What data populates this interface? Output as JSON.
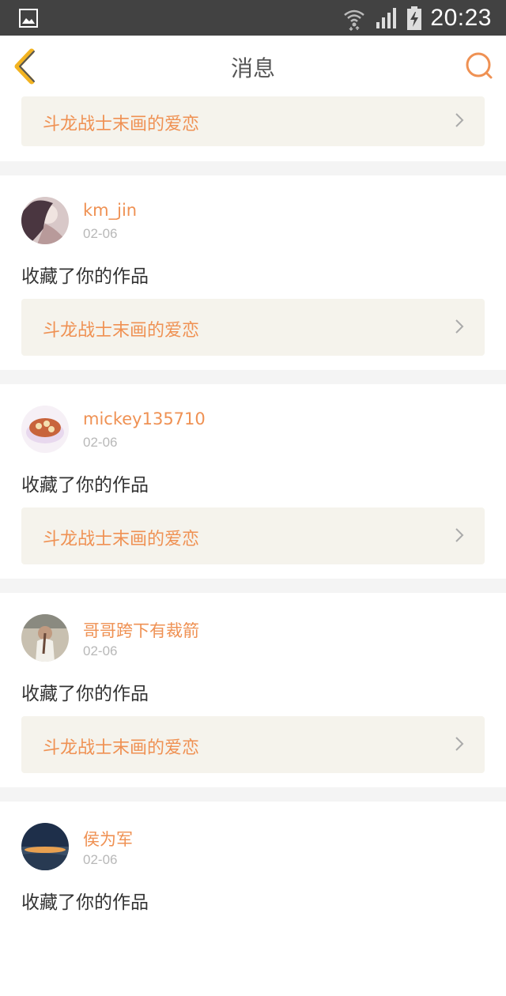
{
  "status_bar": {
    "time": "20:23",
    "icons": [
      "gallery-icon",
      "wifi-icon",
      "signal-icon",
      "battery-charging-icon"
    ]
  },
  "nav": {
    "title": "消息",
    "back_icon": "chevron-left-icon",
    "search_icon": "search-icon"
  },
  "colors": {
    "accent": "#ef9153",
    "back_icon": "#f2b321",
    "link_bg": "#f5f3ec"
  },
  "top_partial": {
    "work_title": "斗龙战士末画的爱恋"
  },
  "messages": [
    {
      "username": "km_jin",
      "date": "02-06",
      "action": "收藏了你的作品",
      "work_title": "斗龙战士末画的爱恋"
    },
    {
      "username": "mickey135710",
      "date": "02-06",
      "action": "收藏了你的作品",
      "work_title": "斗龙战士末画的爱恋"
    },
    {
      "username": "哥哥跨下有裁箭",
      "date": "02-06",
      "action": "收藏了你的作品",
      "work_title": "斗龙战士末画的爱恋"
    },
    {
      "username": "侯为军",
      "date": "02-06",
      "action": "收藏了你的作品"
    }
  ]
}
